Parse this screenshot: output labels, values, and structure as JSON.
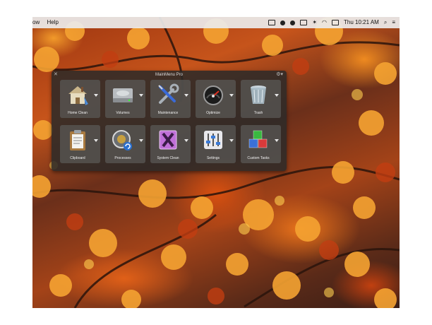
{
  "menubar": {
    "app_fragment": "ow",
    "menu_help": "Help",
    "clock": "Thu 10:21 AM"
  },
  "panel": {
    "title": "MainMenu Pro",
    "tiles": [
      {
        "label": "Home Clean",
        "icon": "house-broom-icon"
      },
      {
        "label": "Volumes",
        "icon": "hard-drive-icon"
      },
      {
        "label": "Maintenance",
        "icon": "wrench-screwdriver-icon"
      },
      {
        "label": "Optimize",
        "icon": "speedometer-icon"
      },
      {
        "label": "Trash",
        "icon": "trash-can-icon"
      },
      {
        "label": "Clipboard",
        "icon": "clipboard-icon"
      },
      {
        "label": "Processes",
        "icon": "processes-gear-icon"
      },
      {
        "label": "System Clean",
        "icon": "system-clean-icon"
      },
      {
        "label": "Settings",
        "icon": "sliders-icon"
      },
      {
        "label": "Custom Tasks",
        "icon": "cubes-icon"
      }
    ]
  },
  "colors": {
    "panel_bg": "#2d2a28",
    "tile_bg": "#5a5856",
    "wallpaper_orange": "#e8721a"
  }
}
